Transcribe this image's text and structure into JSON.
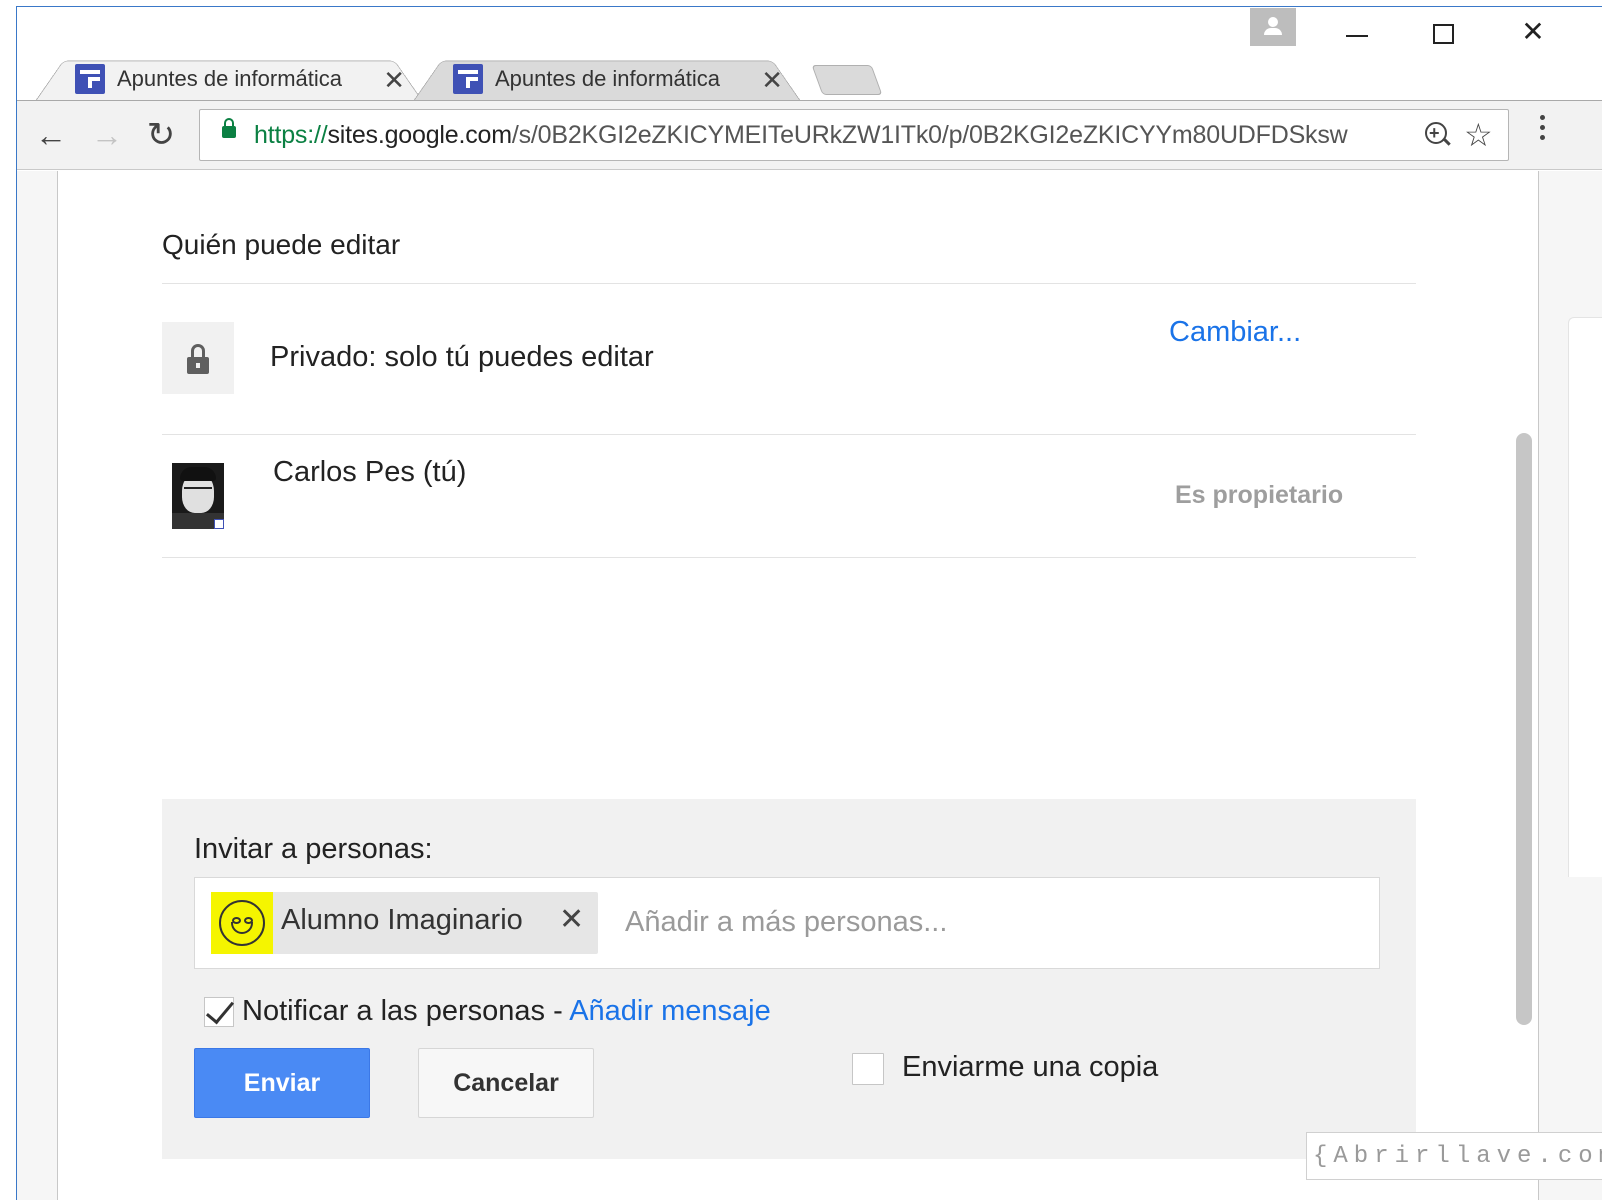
{
  "browser": {
    "tabs": [
      {
        "title": "Apuntes de informática",
        "active": true
      },
      {
        "title": "Apuntes de informática",
        "active": false
      }
    ],
    "tab_close_glyph": "✕",
    "window_controls": {
      "minimize": "minimize",
      "maximize": "maximize",
      "close": "✕"
    },
    "nav": {
      "back": "←",
      "forward": "→",
      "reload": "↻"
    },
    "url": {
      "scheme": "https://",
      "host": "sites.google.com",
      "path": "/s/0B2KGI2eZKICYMEITeURkZW1ITk0/p/0B2KGI2eZKICYYm80UDFDSksw"
    },
    "star": "☆"
  },
  "dialog": {
    "title": "Quién puede editar",
    "privacy": {
      "text": "Privado: solo tú puedes editar",
      "change_link": "Cambiar..."
    },
    "owner": {
      "name": "Carlos Pes (tú)",
      "role": "Es propietario"
    },
    "invite": {
      "label": "Invitar a personas:",
      "chip_name": "Alumno Imaginario",
      "chip_remove": "✕",
      "input_placeholder": "Añadir a más personas...",
      "notify_text": "Notificar a las personas - ",
      "notify_checked": true,
      "add_message_link": "Añadir mensaje",
      "send_button": "Enviar",
      "cancel_button": "Cancelar",
      "copy_label": "Enviarme una copia",
      "copy_checked": false
    }
  },
  "watermark": "{Abrirllave.com"
}
